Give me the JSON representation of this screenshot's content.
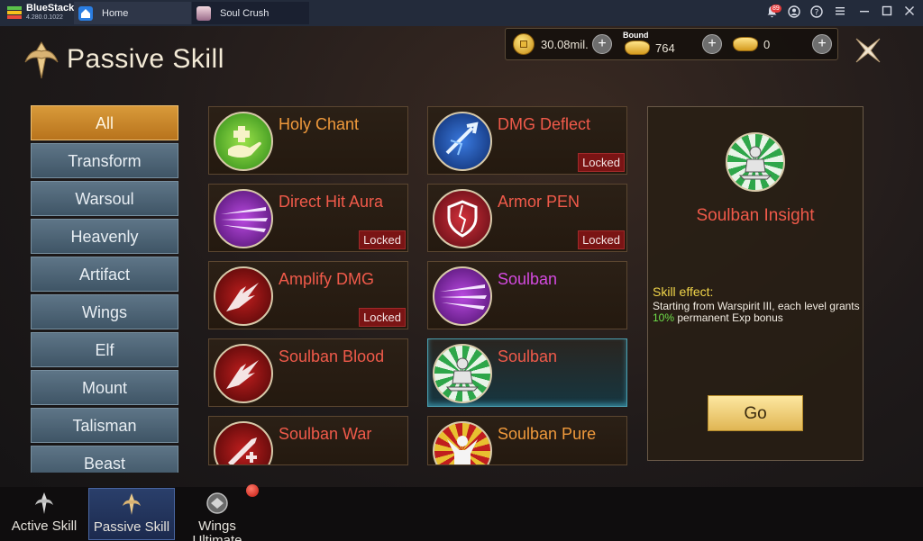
{
  "window": {
    "app_name": "BlueStacks",
    "app_version": "4.280.0.1022",
    "notification_count": "89",
    "tabs": [
      {
        "label": "Home",
        "icon": "home-icon"
      },
      {
        "label": "Soul Crush",
        "icon": "game-avatar-icon"
      }
    ]
  },
  "header": {
    "title": "Passive Skill",
    "currency": [
      {
        "icon": "gold-coin-icon",
        "value": "30.08mil."
      },
      {
        "icon": "bound-ingot-icon",
        "tag": "Bound",
        "value": "764"
      },
      {
        "icon": "ingot-icon",
        "value": "0"
      }
    ]
  },
  "sidebar": {
    "items": [
      {
        "label": "All",
        "active": true
      },
      {
        "label": "Transform"
      },
      {
        "label": "Warsoul"
      },
      {
        "label": "Heavenly"
      },
      {
        "label": "Artifact"
      },
      {
        "label": "Wings"
      },
      {
        "label": "Elf"
      },
      {
        "label": "Mount"
      },
      {
        "label": "Talisman"
      },
      {
        "label": "Beast"
      }
    ]
  },
  "skills": [
    {
      "name": "Holy Chant",
      "locked": "",
      "icon": "healing-hand-icon"
    },
    {
      "name": "DMG Deflect",
      "locked": "Locked",
      "icon": "deflect-icon"
    },
    {
      "name": "Direct Hit Aura",
      "locked": "Locked",
      "icon": "slash-aura-icon"
    },
    {
      "name": "Armor PEN",
      "locked": "Locked",
      "icon": "broken-shield-icon"
    },
    {
      "name": "Amplify DMG",
      "locked": "Locked",
      "icon": "flame-blade-icon"
    },
    {
      "name": "Soulban",
      "locked": "",
      "icon": "slash-aura-icon"
    },
    {
      "name": "Soulban Blood",
      "locked": "",
      "icon": "flame-blade-icon"
    },
    {
      "name": "Soulban",
      "locked": "",
      "icon": "meditating-figure-icon"
    },
    {
      "name": "Soulban War",
      "locked": "",
      "icon": "sword-icon"
    },
    {
      "name": "Soulban Pure",
      "locked": "",
      "icon": "warrior-burst-icon"
    }
  ],
  "detail": {
    "name": "Soulban Insight",
    "effect_label": "Skill effect:",
    "effect_text_before": "Starting from Warspirit III, each level grants ",
    "effect_pct": "10%",
    "effect_text_after": " permanent Exp bonus",
    "go_label": "Go"
  },
  "bottom_tabs": [
    {
      "label": "Active Skill"
    },
    {
      "label": "Passive Skill",
      "active": true
    },
    {
      "label": "Wings Ultimate"
    }
  ],
  "colors": {
    "accent_orange": "#f09a3c",
    "accent_red": "#f05a4a",
    "accent_purple": "#d44ae0",
    "locked_bg": "#7a1414",
    "exp_green": "#6fe04a"
  }
}
